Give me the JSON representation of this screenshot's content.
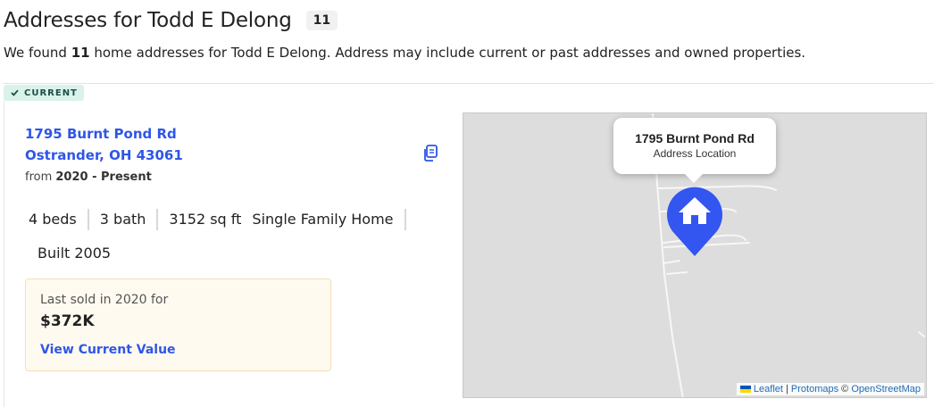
{
  "header": {
    "title": "Addresses for Todd E Delong",
    "count": "11"
  },
  "summary": {
    "prefix": "We found ",
    "count": "11",
    "suffix": " home addresses for Todd E Delong. Address may include current or past addresses and owned properties."
  },
  "address_card": {
    "tag": "CURRENT",
    "street": "1795 Burnt Pond Rd",
    "city_line": "Ostrander, OH 43061",
    "from_prefix": "from ",
    "from_range": "2020 - Present",
    "facts": [
      "4 beds",
      "3 bath",
      "3152 sq ft",
      "Single Family Home"
    ],
    "built": "Built 2005",
    "sold": {
      "label": "Last sold in 2020 for",
      "value": "$372K",
      "link": "View Current Value"
    }
  },
  "map": {
    "popup_title": "1795 Burnt Pond Rd",
    "popup_subtitle": "Address Location",
    "attribution": {
      "leaflet": "Leaflet",
      "sep1": " | ",
      "protomaps": "Protomaps",
      "sep2": " © ",
      "osm": "OpenStreetMap"
    },
    "marker_color": "#3355f0"
  },
  "icons": {
    "check": "check-icon",
    "copy": "copy-icon",
    "marker": "home-marker-icon"
  }
}
